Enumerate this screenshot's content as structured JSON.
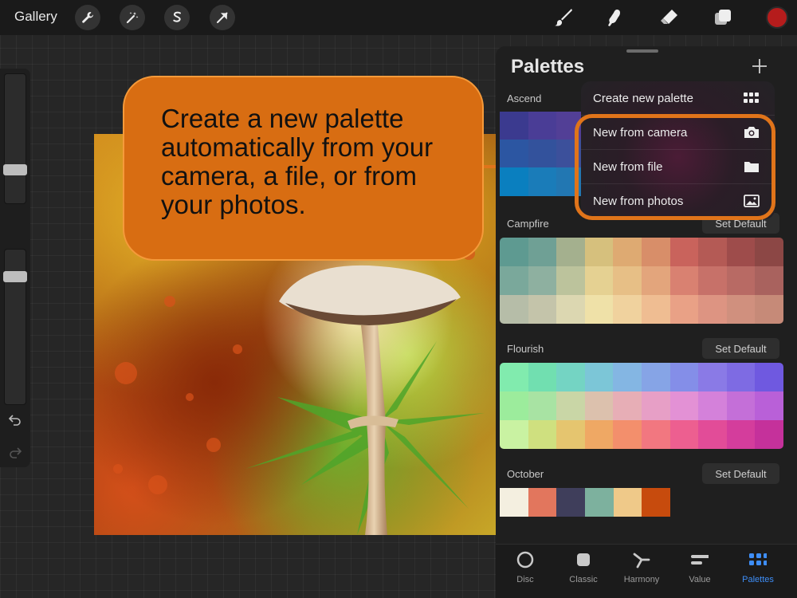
{
  "topbar": {
    "gallery_label": "Gallery",
    "tools_left": [
      "wrench-icon",
      "magic-wand-icon",
      "selection-s-icon",
      "transform-arrow-icon"
    ],
    "tools_right": [
      "brush-icon",
      "smudge-icon",
      "eraser-icon",
      "layers-icon"
    ],
    "current_color": "#b51c1c"
  },
  "callout": {
    "text": "Create a new palette automatically from your camera, a file, or from your photos.",
    "color": "#d86d12"
  },
  "panel": {
    "title": "Palettes",
    "set_default_label": "Set Default",
    "palettes": [
      {
        "name": "Ascend",
        "rows": [
          [
            "#3b3a8f",
            "#4a3d96",
            "#523f96",
            "#5a4a9c",
            "#624f9d",
            "#6a559e"
          ],
          [
            "#2c56a2",
            "#33529c",
            "#3c509b",
            "#444e97",
            "#4a4c94",
            "#514a92"
          ],
          [
            "#0a7fbf",
            "#1a7cb9",
            "#2277b2",
            "#2c73ad",
            "#3470a8",
            "#3b6ca4"
          ]
        ]
      },
      {
        "name": "Campfire",
        "rows": [
          [
            "#5e9a91",
            "#6fa095",
            "#a4b08e",
            "#d6c07d",
            "#deaa72",
            "#d88e69",
            "#c9635c",
            "#b45a55",
            "#9e4c4b",
            "#8c4745"
          ],
          [
            "#7aa89b",
            "#8eb0a0",
            "#bcc39c",
            "#e5d192",
            "#e7bf86",
            "#e3a57c",
            "#d98171",
            "#c77169",
            "#b86a64",
            "#a9625e"
          ],
          [
            "#b6bda8",
            "#c4c4aa",
            "#dcd7b1",
            "#efe1a8",
            "#f0d29e",
            "#efbd92",
            "#e9a186",
            "#dd9482",
            "#d0907e",
            "#c68a78"
          ]
        ]
      },
      {
        "name": "Flourish",
        "rows": [
          [
            "#81ebae",
            "#71dfb0",
            "#74d4c3",
            "#7cc6d7",
            "#84b6e3",
            "#86a4e6",
            "#848ee8",
            "#8a7ae6",
            "#7e6be3",
            "#6f59e0"
          ],
          [
            "#9cec9c",
            "#a8e3a3",
            "#c9d6a6",
            "#dcc1ad",
            "#e7aeb6",
            "#e79fc6",
            "#e391d5",
            "#d481da",
            "#c46fd8",
            "#b960d8"
          ],
          [
            "#c9f2a2",
            "#cfe07f",
            "#e5c56f",
            "#efa864",
            "#f38f6c",
            "#f27780",
            "#ed5f90",
            "#e24c98",
            "#d43d9c",
            "#c5319b"
          ]
        ]
      },
      {
        "name": "October",
        "colors": [
          "#f4efe0",
          "#e2765d",
          "#3f3e5b",
          "#7db19e",
          "#efc989",
          "#c74b0d"
        ]
      }
    ],
    "tabs": [
      {
        "label": "Disc",
        "icon": "disc-icon"
      },
      {
        "label": "Classic",
        "icon": "classic-square-icon"
      },
      {
        "label": "Harmony",
        "icon": "harmony-icon"
      },
      {
        "label": "Value",
        "icon": "value-sliders-icon"
      },
      {
        "label": "Palettes",
        "icon": "palettes-grid-icon",
        "active": true
      }
    ]
  },
  "menu": {
    "items": [
      {
        "label": "Create new palette",
        "icon": "grid-icon"
      },
      {
        "label": "New from camera",
        "icon": "camera-icon"
      },
      {
        "label": "New from file",
        "icon": "folder-icon"
      },
      {
        "label": "New from photos",
        "icon": "photo-icon"
      }
    ]
  }
}
